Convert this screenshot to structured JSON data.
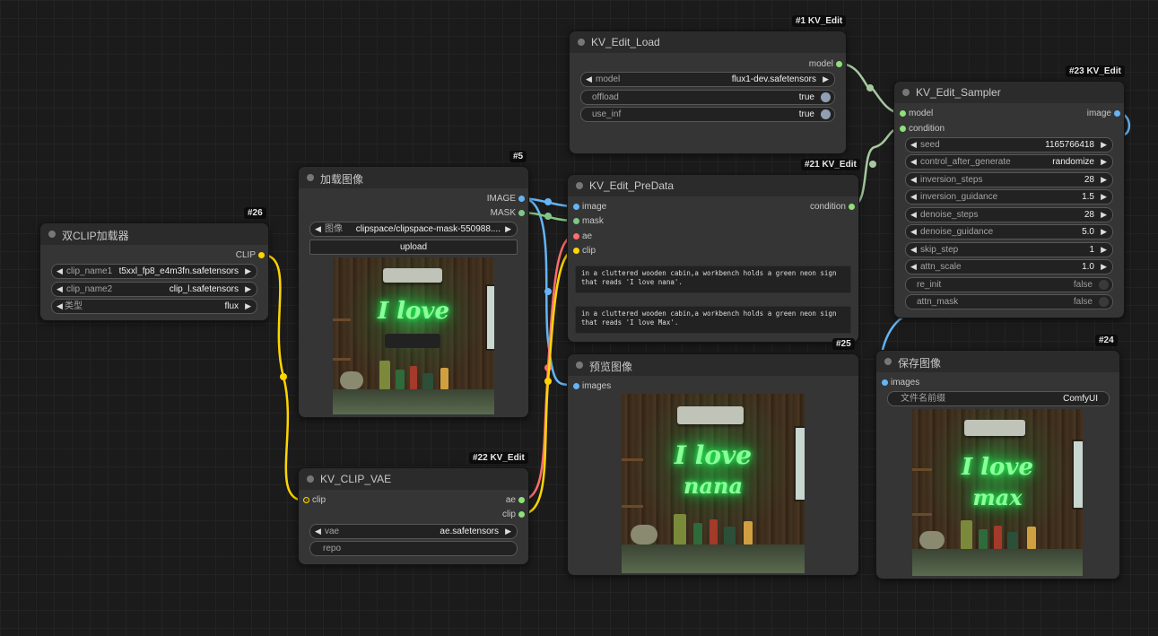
{
  "colors": {
    "model": "#8ee07a",
    "image": "#64b5f6",
    "mask": "#81c784",
    "clip": "#ffd500",
    "vae": "#ff6e6e",
    "condition": "#ffa931",
    "wire_model": "#a6c9a0",
    "wire_image": "#64b5f6",
    "wire_mask": "#81c784",
    "wire_clip": "#ffd500",
    "wire_ae": "#ff6e6e"
  },
  "nodes": {
    "dual_clip": {
      "badge": "#26",
      "title": "双CLIP加载器",
      "output": "CLIP",
      "widgets": [
        {
          "name": "clip_name1",
          "value": "t5xxl_fp8_e4m3fn.safetensors"
        },
        {
          "name": "clip_name2",
          "value": "clip_l.safetensors"
        },
        {
          "name": "类型",
          "value": "flux"
        }
      ]
    },
    "load_image": {
      "badge": "#5",
      "title": "加载图像",
      "outputs": [
        "IMAGE",
        "MASK"
      ],
      "widget": {
        "name": "图像",
        "value": "clipspace/clipspace-mask-550988...."
      },
      "upload": "upload",
      "neon_text": "I love"
    },
    "kv_load": {
      "badge": "#1 KV_Edit",
      "title": "KV_Edit_Load",
      "output": "model",
      "widgets": [
        {
          "name": "model",
          "value": "flux1-dev.safetensors"
        },
        {
          "name": "offload",
          "value": "true"
        },
        {
          "name": "use_inf",
          "value": "true"
        }
      ]
    },
    "kv_predata": {
      "badge": "#21 KV_Edit",
      "title": "KV_Edit_PreData",
      "inputs": [
        "image",
        "mask",
        "ae",
        "clip"
      ],
      "output": "condition",
      "prompt1": "in a cluttered wooden cabin,a workbench holds a green neon sign that reads 'I love nana'.",
      "prompt2": "in a cluttered wooden cabin,a workbench holds a green neon sign that reads 'I love Max'."
    },
    "kv_sampler": {
      "badge": "#23 KV_Edit",
      "title": "KV_Edit_Sampler",
      "inputs": [
        "model",
        "condition"
      ],
      "output": "image",
      "widgets": [
        {
          "name": "seed",
          "value": "1165766418"
        },
        {
          "name": "control_after_generate",
          "value": "randomize"
        },
        {
          "name": "inversion_steps",
          "value": "28"
        },
        {
          "name": "inversion_guidance",
          "value": "1.5"
        },
        {
          "name": "denoise_steps",
          "value": "28"
        },
        {
          "name": "denoise_guidance",
          "value": "5.0"
        },
        {
          "name": "skip_step",
          "value": "1"
        },
        {
          "name": "attn_scale",
          "value": "1.0"
        }
      ],
      "toggles": [
        {
          "name": "re_init",
          "value": "false"
        },
        {
          "name": "attn_mask",
          "value": "false"
        }
      ]
    },
    "kv_clip_vae": {
      "badge": "#22 KV_Edit",
      "title": "KV_CLIP_VAE",
      "input": "clip",
      "outputs": [
        "ae",
        "clip"
      ],
      "widgets": [
        {
          "name": "vae",
          "value": "ae.safetensors"
        },
        {
          "name": "repo",
          "value": ""
        }
      ]
    },
    "preview": {
      "badge": "#25",
      "title": "预览图像",
      "input": "images",
      "neon_line1": "I love",
      "neon_line2": "nana"
    },
    "save": {
      "badge": "#24",
      "title": "保存图像",
      "input": "images",
      "widget": {
        "name": "文件名前缀",
        "value": "ComfyUI"
      },
      "neon_line1": "I love",
      "neon_line2": "max"
    }
  }
}
